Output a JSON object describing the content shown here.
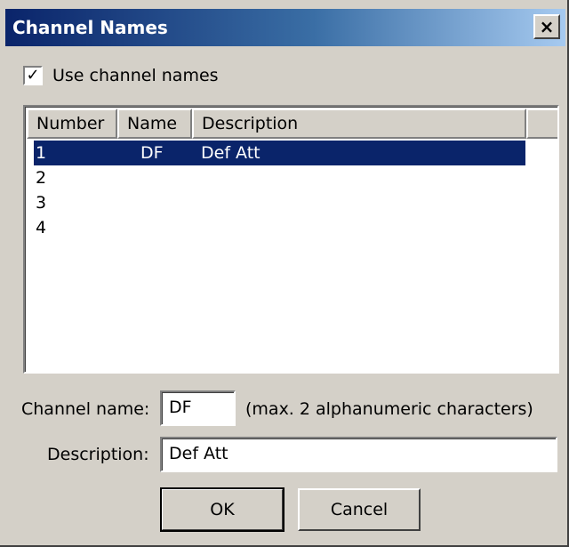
{
  "window": {
    "title": "Channel Names",
    "close_glyph": "×"
  },
  "use_names": {
    "label": "Use channel names",
    "checked": true,
    "check_glyph": "✓"
  },
  "list": {
    "columns": [
      "Number",
      "Name",
      "Description"
    ],
    "rows": [
      {
        "number": "1",
        "name": "DF",
        "description": "Def Att",
        "selected": true
      },
      {
        "number": "2",
        "name": "",
        "description": "",
        "selected": false
      },
      {
        "number": "3",
        "name": "",
        "description": "",
        "selected": false
      },
      {
        "number": "4",
        "name": "",
        "description": "",
        "selected": false
      }
    ]
  },
  "channel_name": {
    "label": "Channel name:",
    "value": "DF",
    "hint": "(max. 2 alphanumeric characters)"
  },
  "description": {
    "label": "Description:",
    "value": "Def Att"
  },
  "buttons": {
    "ok": "OK",
    "cancel": "Cancel"
  },
  "colors": {
    "selection": "#0a246a",
    "dialog_bg": "#d4d0c8"
  }
}
